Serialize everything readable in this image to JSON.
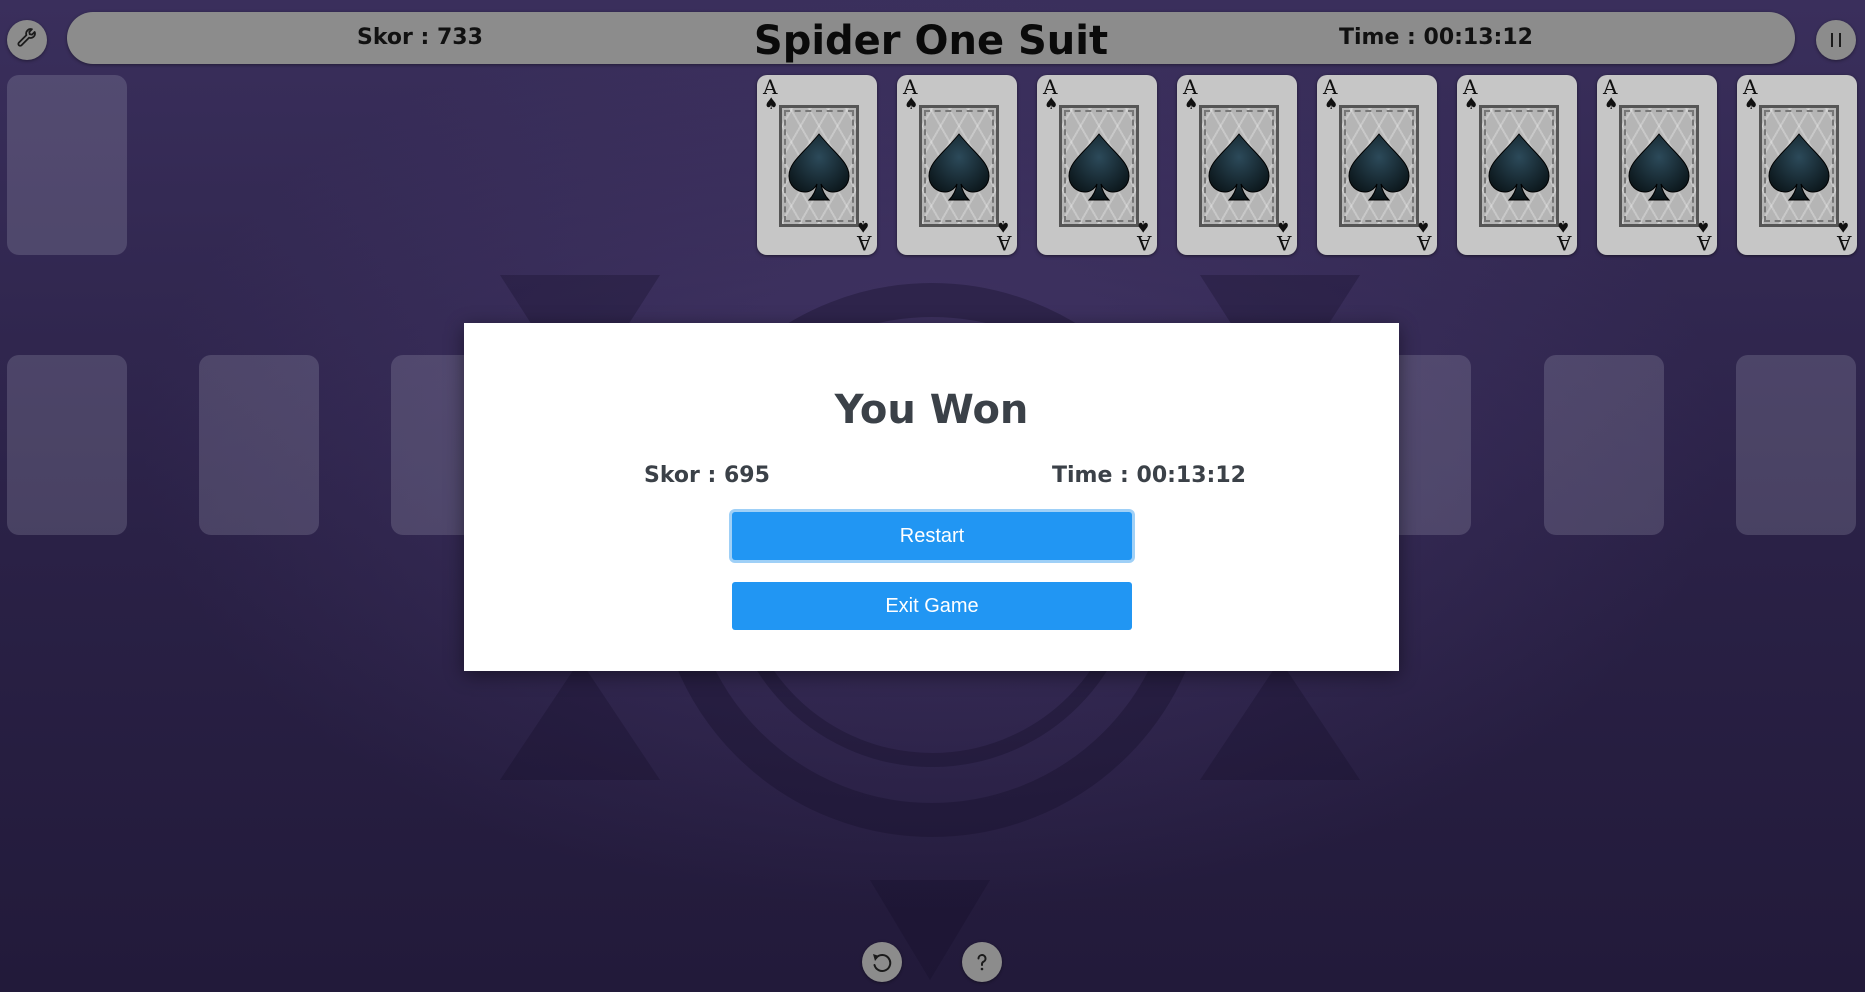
{
  "header": {
    "score_text": "Skor : 733",
    "title": "Spider One Suit",
    "time_text": "Time : 00:13:12"
  },
  "icons": {
    "settings": "wrench-icon",
    "pause": "pause-icon",
    "undo": "undo-icon",
    "help": "help-icon"
  },
  "foundation_cards": [
    {
      "rank": "A",
      "suit": "♠"
    },
    {
      "rank": "A",
      "suit": "♠"
    },
    {
      "rank": "A",
      "suit": "♠"
    },
    {
      "rank": "A",
      "suit": "♠"
    },
    {
      "rank": "A",
      "suit": "♠"
    },
    {
      "rank": "A",
      "suit": "♠"
    },
    {
      "rank": "A",
      "suit": "♠"
    },
    {
      "rank": "A",
      "suit": "♠"
    }
  ],
  "dialog": {
    "title": "You Won",
    "score_text": "Skor : 695",
    "time_text": "Time : 00:13:12",
    "restart_label": "Restart",
    "exit_label": "Exit Game"
  },
  "colors": {
    "background": "#2a2146",
    "bar": "#8c8c8c",
    "button": "#2196f3",
    "dialog_text": "#3b4148"
  }
}
